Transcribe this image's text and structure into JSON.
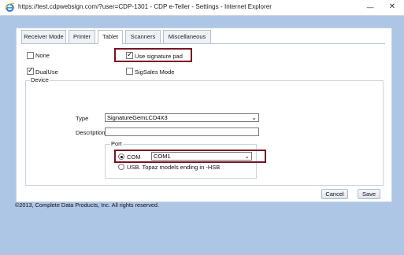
{
  "window": {
    "url_title": "https://test.cdpwebsign.com/?user=CDP-1301 - CDP e-Teller - Settings - Internet Explorer",
    "minimize_glyph": "—",
    "close_glyph": "✕"
  },
  "tabs": [
    {
      "label": "Receiver Mode",
      "active": false
    },
    {
      "label": "Printer",
      "active": false
    },
    {
      "label": "Tablet",
      "active": true
    },
    {
      "label": "Scanners",
      "active": false
    },
    {
      "label": "Miscellaneous",
      "active": false
    }
  ],
  "options": {
    "none": {
      "label": "None",
      "checked": false
    },
    "use_signature_pad": {
      "label": "Use signature pad",
      "checked": true
    },
    "dual_use": {
      "label": "DualUse",
      "checked": true
    },
    "sigsales_mode": {
      "label": "SigSales Mode",
      "checked": false
    }
  },
  "device": {
    "legend": "Device",
    "type_label": "Type",
    "type_value": "SignatureGemLCD4X3",
    "description_label": "Description",
    "description_value": "",
    "port": {
      "legend": "Port",
      "com_label": "COM",
      "com_selected": true,
      "com_value": "COM1",
      "usb_label": "USB. Topaz models ending in -HSB",
      "usb_selected": false
    }
  },
  "buttons": {
    "cancel": "Cancel",
    "save": "Save"
  },
  "footer": {
    "copyright": "©2013, Complete Data Products, Inc. All rights reserved."
  },
  "colors": {
    "background": "#aec6e6",
    "highlight": "#7a1222"
  }
}
